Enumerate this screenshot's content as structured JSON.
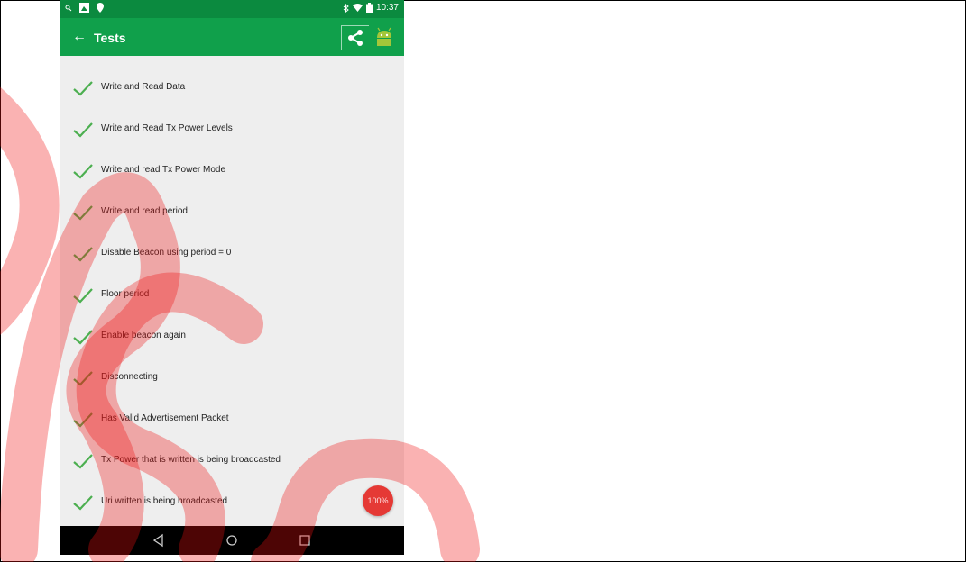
{
  "status_bar": {
    "time": "10:37",
    "icons": [
      "search-icon",
      "notification-icon",
      "location-icon",
      "bluetooth-icon",
      "wifi-icon",
      "battery-icon"
    ]
  },
  "app_bar": {
    "title": "Tests",
    "back_icon": "←",
    "actions": [
      "share-icon",
      "android-icon"
    ]
  },
  "tests": [
    {
      "label": "Write and Read Data",
      "status": "passed"
    },
    {
      "label": "Write and Read Tx Power Levels",
      "status": "passed"
    },
    {
      "label": "Write and read Tx Power Mode",
      "status": "passed"
    },
    {
      "label": "Write and read period",
      "status": "passed"
    },
    {
      "label": "Disable Beacon using period = 0",
      "status": "passed"
    },
    {
      "label": "Floor period",
      "status": "passed"
    },
    {
      "label": "Enable beacon again",
      "status": "passed"
    },
    {
      "label": "Disconnecting",
      "status": "passed"
    },
    {
      "label": "Has Valid Advertisement Packet",
      "status": "passed"
    },
    {
      "label": "Tx Power that is written is being broadcasted",
      "status": "passed"
    },
    {
      "label": "Uri written is being broadcasted",
      "status": "passed"
    }
  ],
  "progress": {
    "label": "100%",
    "value": 100
  },
  "nav_bar": {
    "buttons": [
      "back-triangle-icon",
      "home-circle-icon",
      "recents-square-icon"
    ]
  },
  "colors": {
    "status_bar": "#0b8a3f",
    "app_bar": "#10a04b",
    "check": "#4caf50",
    "fab": "#e53935",
    "watermark": "#ee1111"
  }
}
